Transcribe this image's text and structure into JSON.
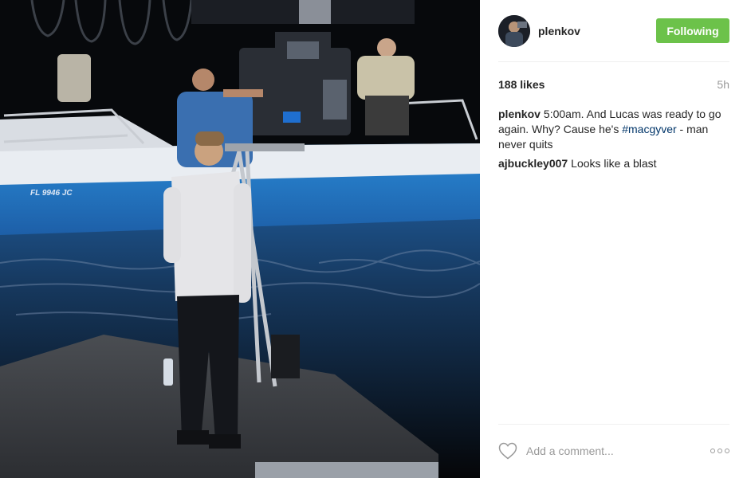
{
  "post": {
    "username": "plenkov",
    "follow_button_label": "Following",
    "likes": "188 likes",
    "time_ago": "5h",
    "caption": {
      "author": "plenkov",
      "text_before": "5:00am. And Lucas was ready to go again. Why? Cause he's ",
      "hashtag": "#macgyver",
      "text_after": " - man never quits"
    },
    "comments": [
      {
        "author": "ajbuckley007",
        "text": "Looks like a blast"
      }
    ],
    "comment_placeholder": "Add a comment...",
    "boat_registration": "FL 9946 JC"
  },
  "colors": {
    "follow_button": "#6cc24a",
    "hashtag": "#003569",
    "muted": "#999999"
  },
  "icons": {
    "like": "heart-outline-icon",
    "more": "more-options-icon"
  }
}
